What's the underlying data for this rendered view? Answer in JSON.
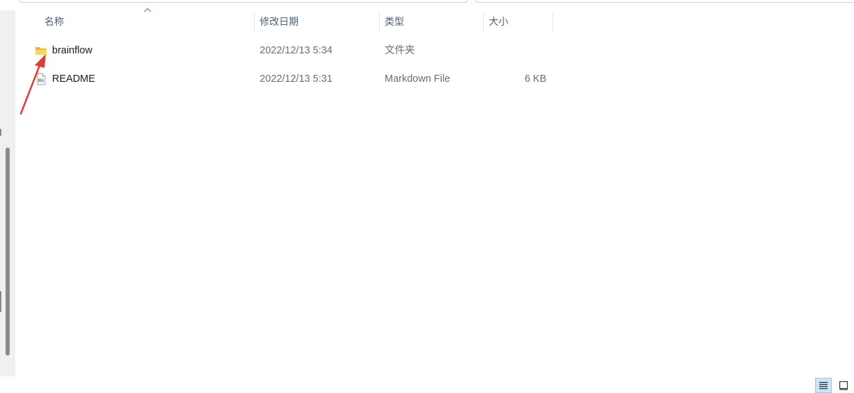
{
  "columns": {
    "name": "名称",
    "date_modified": "修改日期",
    "type": "类型",
    "size": "大小"
  },
  "files": [
    {
      "icon": "folder-icon",
      "name": "brainflow",
      "date_modified": "2022/12/13 5:34",
      "type": "文件夹",
      "size": ""
    },
    {
      "icon": "markdown-file-icon",
      "name": "README",
      "date_modified": "2022/12/13 5:31",
      "type": "Markdown File",
      "size": "6 KB"
    }
  ],
  "view": {
    "active": "details",
    "options": [
      "details-view-icon",
      "large-icons-view-icon"
    ]
  },
  "colors": {
    "header_text": "#4c607a",
    "annotation_arrow": "#e53935",
    "folder": "#f4c542",
    "active_view_bg": "#cce4f7"
  }
}
